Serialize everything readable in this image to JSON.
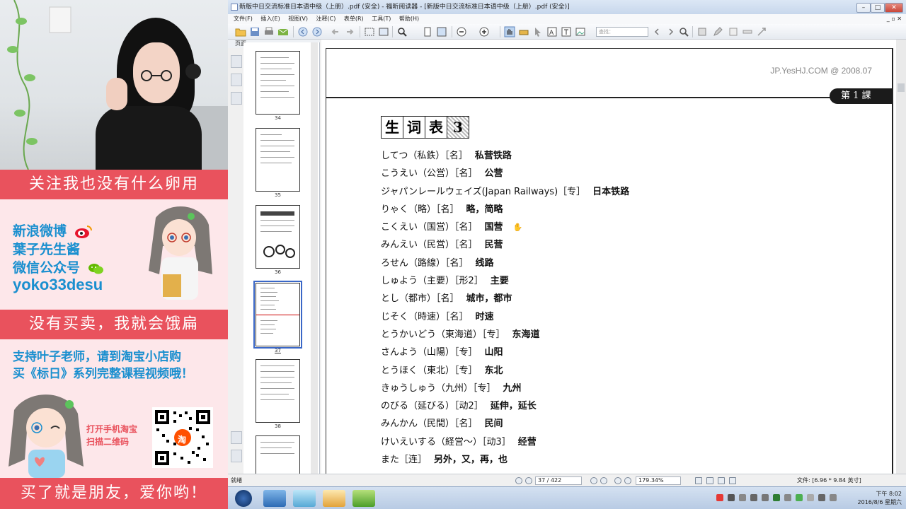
{
  "stream_overlay": {
    "banner_top": "关注我也没有什么卵用",
    "social": {
      "weibo_label": "新浪微博",
      "name": "葉子先生酱",
      "wechat_label": "微信公众号",
      "handle": "yoko33desu"
    },
    "banner_middle": "没有买卖，我就会饿扁",
    "support_line1": "支持叶子老师，请到淘宝小店购",
    "support_line2": "买《标日》系列完整课程视频哦！",
    "qr_caption1": "打开手机淘宝",
    "qr_caption2": "扫描二维码",
    "qr_center_glyph": "淘",
    "banner_bottom": "买了就是朋友，爱你哟！"
  },
  "window": {
    "title": "新版中日交流标准日本语中级（上册）.pdf (安全) - 福昕阅读器 - [新版中日交流标准日本语中级（上册）.pdf (安全)]",
    "min_label": "–",
    "max_label": "□",
    "close_label": "✕"
  },
  "menu": {
    "items": [
      "文件(F)",
      "插入(E)",
      "视图(V)",
      "注释(C)",
      "表单(R)",
      "工具(T)",
      "帮助(H)"
    ],
    "right_controls": "_ ▫ ✕"
  },
  "toolbar": {
    "search_placeholder": "查找："
  },
  "sidebar": {
    "title": "页面",
    "thumbnails": [
      {
        "num": "34"
      },
      {
        "num": "35"
      },
      {
        "num": "36"
      },
      {
        "num": "37",
        "selected": true
      },
      {
        "num": "38"
      }
    ]
  },
  "document": {
    "watermark": "JP.YesHJ.COM @ 2008.07",
    "lesson_tag": "第 1 課",
    "vocab_title": [
      "生",
      "词",
      "表",
      "3"
    ],
    "vocab": [
      {
        "entry": "してつ（私鉄）［名］",
        "meaning": "私营铁路"
      },
      {
        "entry": "こうえい（公営）［名］",
        "meaning": "公营"
      },
      {
        "entry": "ジャパンレールウェイズ(Japan Railways)［专］",
        "meaning": "日本铁路"
      },
      {
        "entry": "りゃく（略）［名］",
        "meaning": "略，简略"
      },
      {
        "entry": "こくえい（国営）［名］",
        "meaning": "国营"
      },
      {
        "entry": "みんえい（民営）［名］",
        "meaning": "民营"
      },
      {
        "entry": "ろせん（路線）［名］",
        "meaning": "线路"
      },
      {
        "entry": "しゅよう（主要）［形2］",
        "meaning": "主要"
      },
      {
        "entry": "とし（都市）［名］",
        "meaning": "城市，都市"
      },
      {
        "entry": "じそく（時速）［名］",
        "meaning": "时速"
      },
      {
        "entry": "とうかいどう（東海道）［专］",
        "meaning": "东海道"
      },
      {
        "entry": "さんよう（山陽）［专］",
        "meaning": "山阳"
      },
      {
        "entry": "とうほく（東北）［专］",
        "meaning": "东北"
      },
      {
        "entry": "きゅうしゅう（九州）［专］",
        "meaning": "九州"
      },
      {
        "entry": "のびる（延びる）［动2］",
        "meaning": "延伸，延长"
      },
      {
        "entry": "みんかん（民間）［名］",
        "meaning": "民间"
      },
      {
        "entry": "けいえいする（経営～）［动3］",
        "meaning": "经营"
      },
      {
        "entry": "また［连］",
        "meaning": "另外，又，再，也"
      }
    ]
  },
  "status": {
    "ready": "就绪",
    "page": "37 / 422",
    "zoom": "179.34%",
    "file_size": "文件: [6.96 * 9.84 英寸]"
  },
  "taskbar": {
    "time": "下午 8:02",
    "date": "2016/8/6 星期六"
  }
}
